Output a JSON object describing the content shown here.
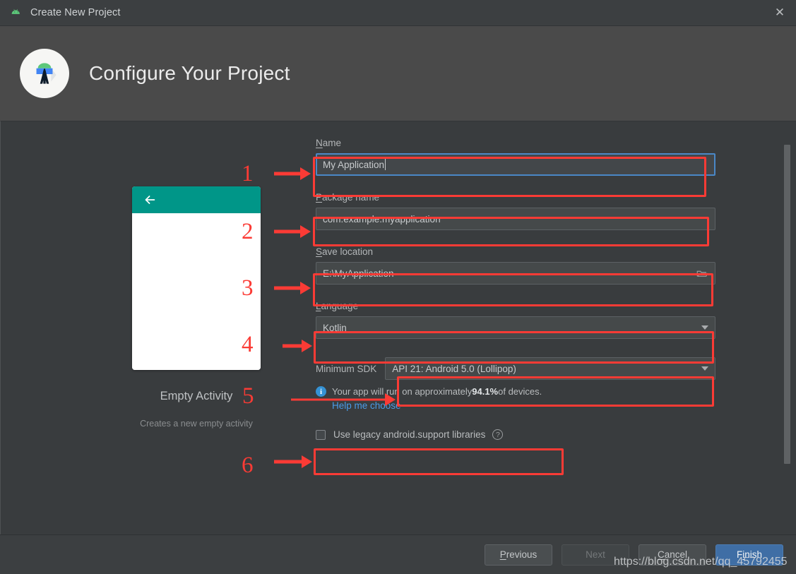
{
  "window": {
    "title": "Create New Project",
    "app_icon": "android-robot-icon",
    "close_label": "✕"
  },
  "header": {
    "title": "Configure Your Project",
    "logo": "android-studio-logo-icon"
  },
  "preview": {
    "template_name": "Empty Activity",
    "template_description": "Creates a new empty activity",
    "appbar_color": "#009688",
    "back_icon": "arrow-left-icon"
  },
  "form": {
    "name": {
      "label": "Name",
      "mnemonic": "N",
      "rest": "ame",
      "value": "My Application",
      "focused": true
    },
    "package_name": {
      "label": "Package name",
      "mnemonic": "P",
      "rest": "ackage name",
      "value": "com.example.myapplication"
    },
    "save_location": {
      "label": "Save location",
      "mnemonic": "S",
      "rest": "ave location",
      "value": "E:\\MyApplication",
      "browse_icon": "folder-icon"
    },
    "language": {
      "label": "Language",
      "mnemonic": "L",
      "rest": "anguage",
      "value": "Kotlin",
      "arrow_icon": "chevron-down-icon"
    },
    "minimum_sdk": {
      "label": "Minimum SDK",
      "value": "API 21: Android 5.0 (Lollipop)",
      "arrow_icon": "chevron-down-icon"
    },
    "device_info": {
      "icon": "info-icon",
      "prefix": "Your app will run on approximately ",
      "percent": "94.1%",
      "suffix": " of devices.",
      "help_link": "Help me choose"
    },
    "legacy_libraries": {
      "label": "Use legacy android.support libraries",
      "checked": false,
      "help_icon": "question-mark-icon"
    }
  },
  "footer": {
    "previous": {
      "mnemonic": "P",
      "rest": "revious"
    },
    "next": {
      "label": "Next",
      "disabled": true
    },
    "cancel": {
      "mnemonic": "C",
      "rest": "ancel"
    },
    "finish": {
      "mnemonic": "F",
      "pre": "",
      "mid": "i",
      "rest": "nish",
      "label": "Finish",
      "primary": true
    }
  },
  "annotations": {
    "numbers": [
      "1",
      "2",
      "3",
      "4",
      "5",
      "6"
    ],
    "color": "#fb3b35"
  },
  "watermark": {
    "text": "https://blog.csdn.net/qq_45792455"
  },
  "colors": {
    "header_bg": "#4a4a4a",
    "body_bg": "#393c3e",
    "chrome_bg": "#3c3f41",
    "accent_blue": "#4a88c7",
    "primary_button": "#3f6ea5",
    "link": "#4a9be8",
    "annotation_red": "#fb3b35"
  }
}
